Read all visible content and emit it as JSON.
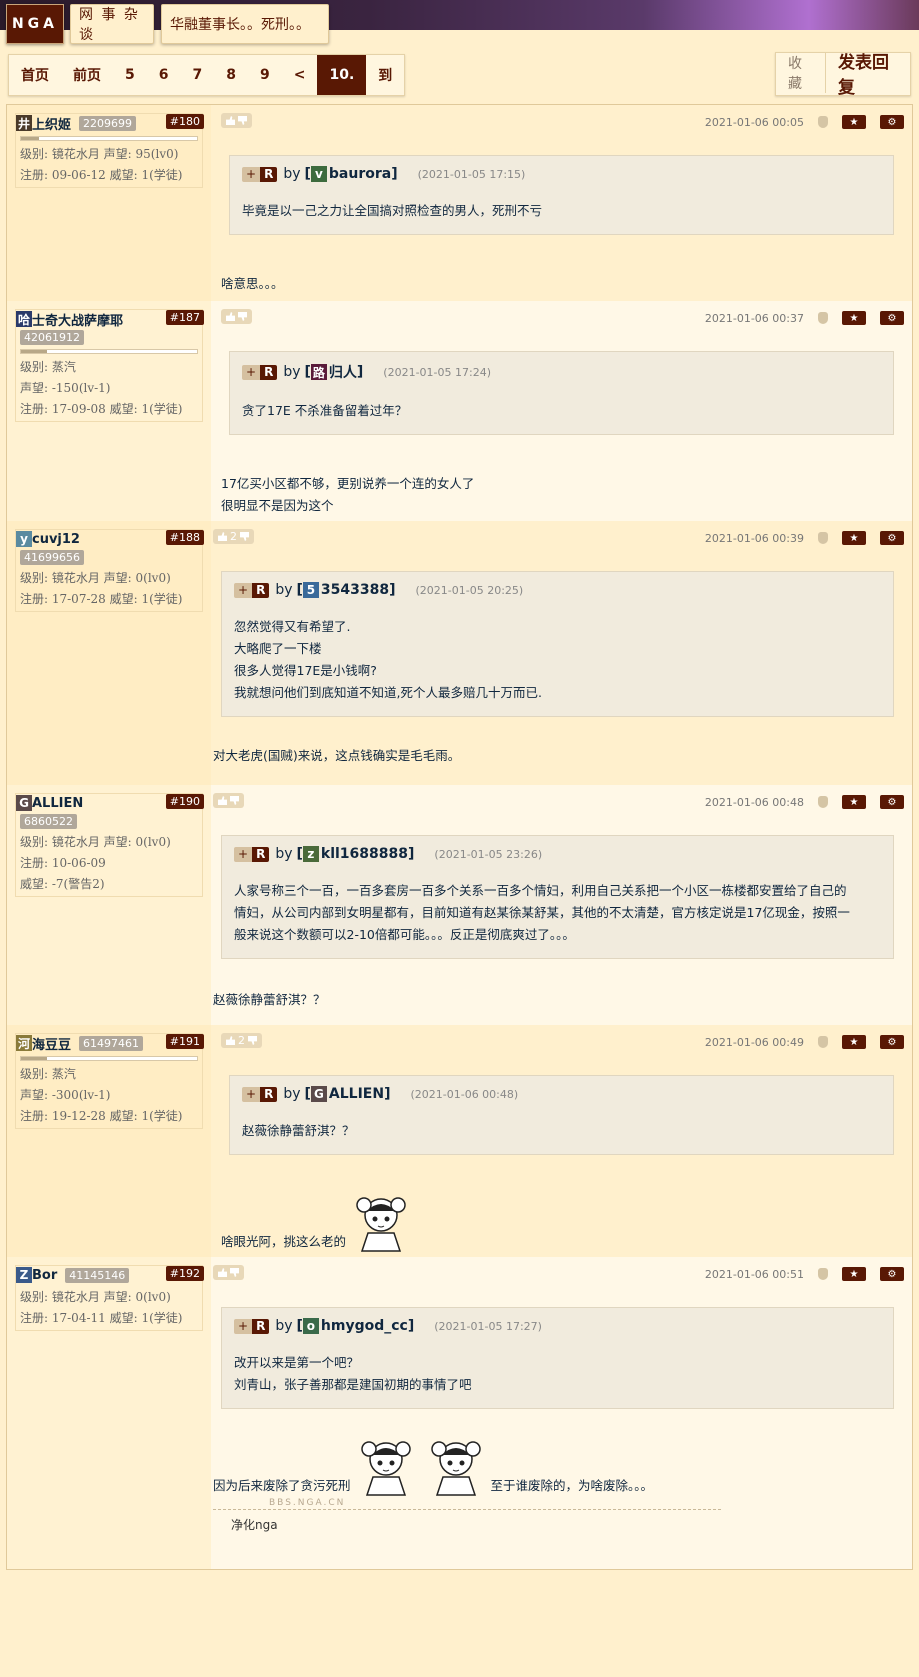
{
  "header": {
    "logo": "NGA",
    "forum": "网 事 杂 谈",
    "thread": "华融董事长。。死刑。。"
  },
  "pager": {
    "items": [
      "首页",
      "前页",
      "5",
      "6",
      "7",
      "8",
      "9",
      "<",
      "10.",
      "到"
    ],
    "current": "10.",
    "fav": "收藏",
    "reply": "发表回复"
  },
  "posts": [
    {
      "avatar": "井",
      "avatar_color": "#4a3a2a",
      "name": "上织姬",
      "uid": "2209699",
      "floor": "#180",
      "bar": 0.1,
      "lines": [
        "级别: 镜花水月  声望: 95(lv0)",
        "注册: 09-06-12  威望: 1(学徒)"
      ],
      "votes": "",
      "time": "2021-01-06 00:05",
      "quote": {
        "avatar": "v",
        "avatar_color": "#3d6b3d",
        "name": "baurora",
        "time": "(2021-01-05 17:15)",
        "body": [
          "毕竟是以一己之力让全国搞对照检查的男人，死刑不亏"
        ]
      },
      "content": [
        "啥意思。。。"
      ]
    },
    {
      "avatar": "哈",
      "avatar_color": "#2a3a6a",
      "name": "士奇大战萨摩耶",
      "uid": "42061912",
      "floor": "#187",
      "bar": 0.15,
      "lines": [
        "级别: 蒸汽",
        "声望: -150(lv-1)",
        "注册: 17-09-08  威望: 1(学徒)"
      ],
      "votes": "",
      "time": "2021-01-06 00:37",
      "quote": {
        "avatar": "路",
        "avatar_color": "#5a1a3a",
        "name": "归人",
        "time": "(2021-01-05 17:24)",
        "body": [
          "贪了17E 不杀准备留着过年？"
        ]
      },
      "content": [
        "17亿买小区都不够，更别说养一个连的女人了",
        "很明显不是因为这个"
      ]
    },
    {
      "avatar": "y",
      "avatar_color": "#5a8aa0",
      "name": "cuvj12",
      "uid": "41699656",
      "floor": "#188",
      "bar": 0,
      "lines": [
        "级别: 镜花水月  声望: 0(lv0)",
        "注册: 17-07-28  威望: 1(学徒)"
      ],
      "votes": "2",
      "time": "2021-01-06 00:39",
      "quote": {
        "avatar": "5",
        "avatar_color": "#3a6a9a",
        "name": "3543388",
        "time": "(2021-01-05 20:25)",
        "body": [
          "忽然觉得又有希望了.",
          "大略爬了一下楼",
          "很多人觉得17E是小钱啊?",
          "我就想问他们到底知道不知道,死个人最多赔几十万而已."
        ]
      },
      "content": [
        "对大老虎(国贼)来说，这点钱确实是毛毛雨。"
      ]
    },
    {
      "avatar": "G",
      "avatar_color": "#5a4a4a",
      "name": "ALLIEN",
      "uid": "6860522",
      "floor": "#190",
      "bar": 0,
      "lines": [
        "级别: 镜花水月  声望: 0(lv0)",
        "注册: 10-06-09",
        "威望: -7(警告2)"
      ],
      "votes": "",
      "time": "2021-01-06 00:48",
      "quote": {
        "avatar": "z",
        "avatar_color": "#4a6a3a",
        "name": "kll1688888",
        "time": "(2021-01-05 23:26)",
        "body": [
          "人家号称三个一百，一百多套房一百多个关系一百多个情妇，利用自己关系把一个小区一栋楼都安置给了自己的",
          "情妇，从公司内部到女明星都有，目前知道有赵某徐某舒某，其他的不太清楚，官方核定说是17亿现金，按照一",
          "般来说这个数额可以2-10倍都可能。。。反正是彻底爽过了。。。"
        ]
      },
      "content": [
        "赵薇徐静蕾舒淇？？"
      ]
    },
    {
      "avatar": "河",
      "avatar_color": "#8a7a3a",
      "name": "海豆豆",
      "uid": "61497461",
      "floor": "#191",
      "bar": 0.15,
      "lines": [
        "级别: 蒸汽",
        "声望: -300(lv-1)",
        "注册: 19-12-28  威望: 1(学徒)"
      ],
      "votes": "2",
      "time": "2021-01-06 00:49",
      "quote": {
        "avatar": "G",
        "avatar_color": "#5a4a4a",
        "name": "ALLIEN",
        "time": "(2021-01-06 00:48)",
        "body": [
          "赵薇徐静蕾舒淇？？"
        ]
      },
      "content": [
        "啥眼光阿，挑这么老的"
      ]
    },
    {
      "avatar": "Z",
      "avatar_color": "#3a5a8a",
      "name": "Bor",
      "uid": "41145146",
      "floor": "#192",
      "bar": 0,
      "lines": [
        "级别: 镜花水月  声望: 0(lv0)",
        "注册: 17-04-11  威望: 1(学徒)"
      ],
      "votes": "",
      "time": "2021-01-06 00:51",
      "quote": {
        "avatar": "o",
        "avatar_color": "#3a6a4a",
        "name": "hmygod_cc",
        "time": "(2021-01-05 17:27)",
        "body": [
          "改开以来是第一个吧？",
          "刘青山，张子善那都是建国初期的事情了吧"
        ]
      },
      "content": [
        "因为后来废除了贪污死刑",
        "至于谁废除的，为啥废除。。。"
      ],
      "signature": "净化nga",
      "watermark": "BBS.NGA.CN"
    }
  ],
  "labels": {
    "by": "by",
    "plus": "+",
    "r": "R"
  },
  "colors": {
    "accent": "#591804",
    "bg": "#fff0cd"
  }
}
